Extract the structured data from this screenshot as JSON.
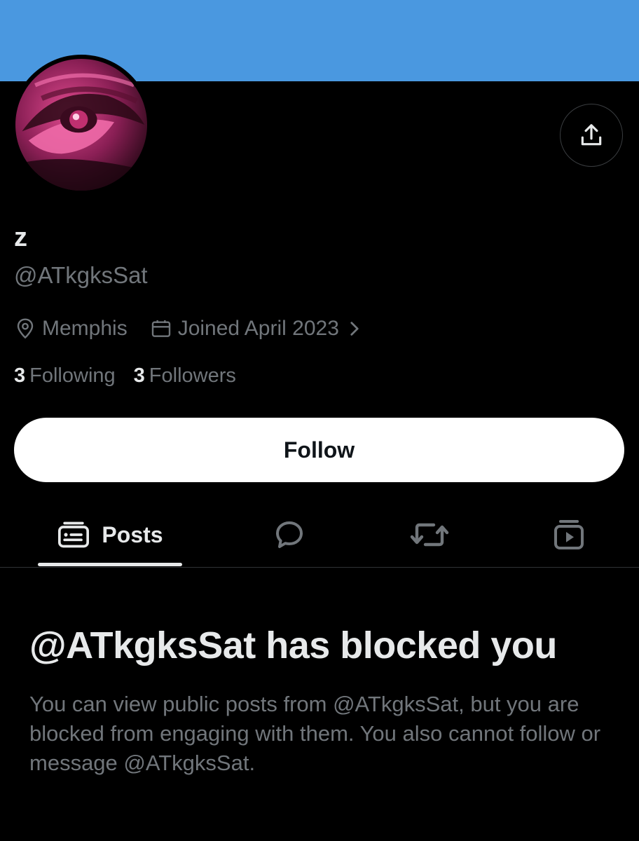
{
  "colors": {
    "banner": "#4a98e0",
    "background": "#000000",
    "text_primary": "#e7e9ea",
    "text_secondary": "#71767b",
    "follow_button_bg": "#ffffff",
    "divider": "#2f3336"
  },
  "header": {
    "share_icon": "share-upload-icon"
  },
  "profile": {
    "display_name": "z",
    "handle": "@ATkgksSat",
    "location": "Memphis",
    "joined": "Joined April 2023",
    "following_count": "3",
    "following_label": "Following",
    "followers_count": "3",
    "followers_label": "Followers"
  },
  "actions": {
    "follow_label": "Follow"
  },
  "tabs": [
    {
      "label": "Posts",
      "icon": "posts-icon",
      "selected": true
    },
    {
      "label": "",
      "icon": "reply-bubble-icon",
      "selected": false
    },
    {
      "label": "",
      "icon": "repost-icon",
      "selected": false
    },
    {
      "label": "",
      "icon": "media-icon",
      "selected": false
    }
  ],
  "blocked": {
    "title": "@ATkgksSat has blocked you",
    "description": "You can view public posts from @ATkgksSat, but you are blocked from engaging with them. You also cannot follow or message @ATkgksSat."
  }
}
